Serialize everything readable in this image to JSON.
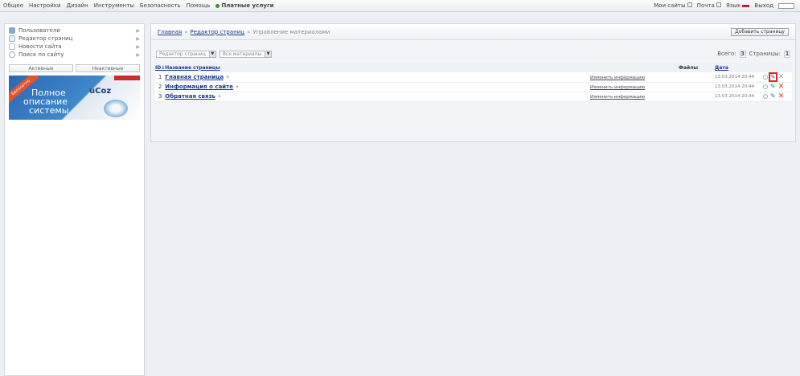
{
  "topmenu": {
    "items": [
      "Общее",
      "Настройки",
      "Дизайн",
      "Инструменты",
      "Безопасность",
      "Помощь"
    ],
    "paid": "Платные услуги"
  },
  "topright": {
    "my_sites": "Мои сайты",
    "manager": "Почта",
    "lang": "Язык",
    "exit": "Выход"
  },
  "sidebar": {
    "items": [
      {
        "label": "Пользователи",
        "icon": "users-icon"
      },
      {
        "label": "Редактор страниц",
        "icon": "page-icon"
      },
      {
        "label": "Новости сайта",
        "icon": "news-icon"
      },
      {
        "label": "Поиск по сайту",
        "icon": "search-icon"
      }
    ],
    "tabs": [
      "Активные",
      "Неактивные"
    ],
    "banner": {
      "ribbon": "Бесплатно",
      "line1": "Полное",
      "line2": "описание",
      "line3": "системы",
      "brand": "uCoz"
    }
  },
  "breadcrumb": {
    "items": [
      "Главная",
      "Редактор страниц",
      "Управление материалами"
    ]
  },
  "add_button": "Добавить страницу",
  "filters": {
    "type": "Редактор страниц",
    "materials": "Все материалы"
  },
  "counts": {
    "total_label": "Всего:",
    "total": "3",
    "pages_label": "Страницы:",
    "pages": "1"
  },
  "table": {
    "headers": {
      "id": "ID↓",
      "title": "Название страницы",
      "files": "Файлы",
      "date": "Дата"
    },
    "rows": [
      {
        "id": "1",
        "title": "Главная страница",
        "link": "Изменить информацию",
        "date": "13.03.2014 20:44"
      },
      {
        "id": "2",
        "title": "Информация о сайте",
        "link": "Изменить информацию",
        "date": "13.03.2014 20:44"
      },
      {
        "id": "3",
        "title": "Обратная связь",
        "link": "Изменить информацию",
        "date": "13.03.2014 20:44"
      }
    ]
  },
  "colors": {
    "accent": "#1a3b8a",
    "highlight": "#e0242b",
    "delete": "#d0392b"
  }
}
